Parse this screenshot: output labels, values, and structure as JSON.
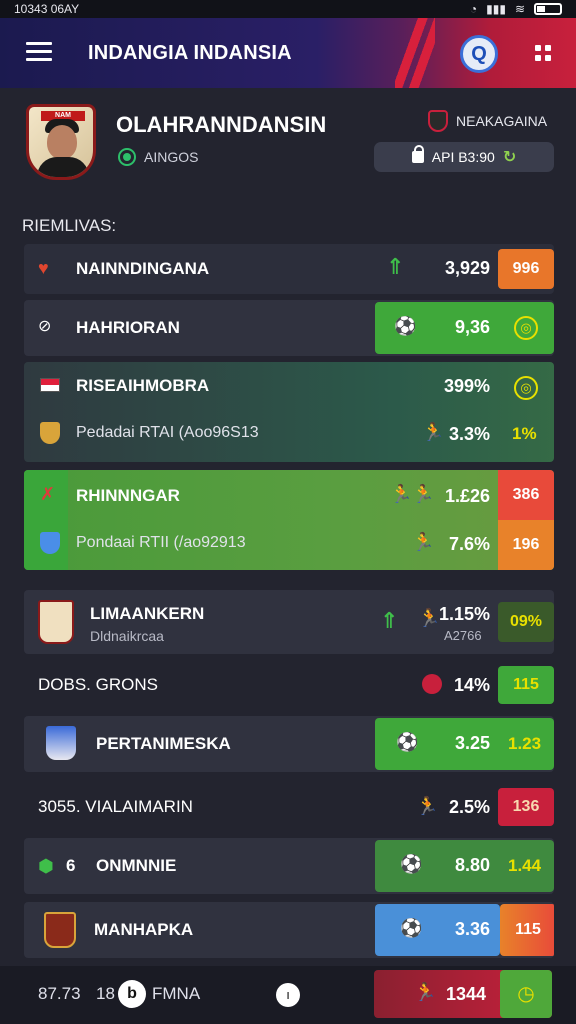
{
  "status_bar": {
    "time": "10343 06AY",
    "battery": "battery"
  },
  "app_bar": {
    "title": "INDANGIA INDANSIA",
    "search_icon": "Q"
  },
  "profile": {
    "name": "OLAHRANNDANSIN",
    "sub": "AINGOS",
    "club": "NEAKAGAINA",
    "api": "API B3:90",
    "crest_band": "NAM"
  },
  "section_label": "RIEMLIVAS:",
  "rows": [
    {
      "label": "NAINNDINGANA",
      "value": "3,929",
      "tag": "996",
      "tag_color": "#e8762a"
    },
    {
      "label": "HAHRIORAN",
      "value": "9,36",
      "tag": "ball"
    },
    {
      "label": "RISEAIHMOBRA",
      "value": "399%",
      "sub": "Pedadai RTAI (Aoo96S13",
      "sub_value": "3.3%",
      "tag": "1%"
    },
    {
      "label": "RHINNNGAR",
      "value": "1.£26",
      "tag": "386",
      "sub": "Pondaai RTII (/ao92913",
      "sub_value": "7.6%",
      "sub_tag": "196"
    },
    {
      "label": "LIMAANKERN",
      "sub": "Dldnaikrcaa",
      "value": "1.15%",
      "sub_value": "A2766",
      "tag": "09%"
    },
    {
      "label": "DOBS.  GRONS",
      "value": "14%",
      "tag": "115"
    },
    {
      "label": "PERTANIMESKA",
      "value": "3.25",
      "tag": "1.23"
    },
    {
      "label": "3055.  VIALAIMARIN",
      "value": "2.5%",
      "tag": "136"
    },
    {
      "label": "ONMNNIE",
      "prefix": "6",
      "value": "8.80",
      "tag": "1.44"
    },
    {
      "label": "MANHAPKA",
      "value": "3.36",
      "tag": "115"
    }
  ],
  "bottom": {
    "left": "87.73",
    "mid": "18",
    "brand": "FMNA",
    "value": "1344"
  }
}
